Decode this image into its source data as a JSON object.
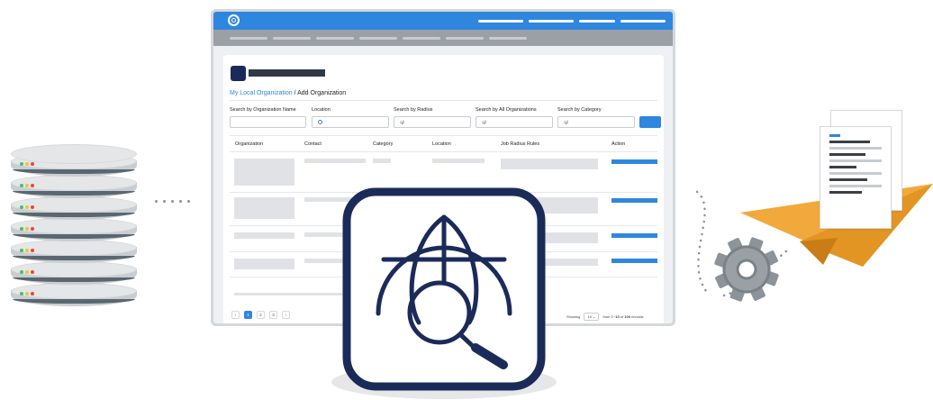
{
  "breadcrumb": {
    "parent": "My Local Organization",
    "separator": " / ",
    "current": "Add Organization"
  },
  "filters": {
    "name_label": "Search by Organization Name",
    "location_label": "Location",
    "radius_label": "Search by Radius",
    "radius_value": "All",
    "organizations_label": "Search by All Organizations",
    "organizations_value": "All",
    "category_label": "Search by Category",
    "category_value": "All"
  },
  "table": {
    "headers": [
      "Organization",
      "Contact",
      "Category",
      "Location",
      "Job Radius Rules",
      "Action"
    ]
  },
  "pagination": {
    "prev": "‹",
    "pages": [
      "1",
      "2",
      "3"
    ],
    "next": "›",
    "showing_label": "Showing",
    "page_size": "10",
    "from_text": "from",
    "range_start": "1",
    "range_to": "~",
    "range_end": "10",
    "of_text": "of",
    "total": "100",
    "records_text": "records"
  },
  "colors": {
    "accent": "#2f86de",
    "navy": "#1b2b59",
    "paper_plane": "#f2a93b",
    "gear": "#8c9499",
    "led_green": "#3cc46a",
    "led_yellow": "#f4c430",
    "led_red": "#e8473c"
  },
  "icons": {
    "center": "globe-search-icon",
    "left": "database-stack-icon",
    "right": "paper-plane-documents-icon",
    "gear": "gear-icon"
  }
}
